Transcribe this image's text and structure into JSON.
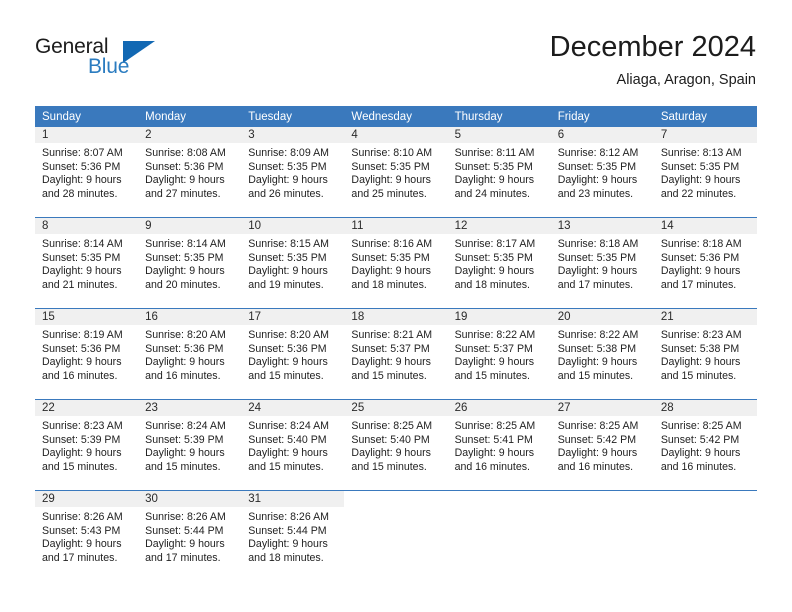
{
  "brand": {
    "name_part1": "General",
    "name_part2": "Blue",
    "logo_icon": "triangle-logo-icon"
  },
  "header": {
    "title": "December 2024",
    "subtitle": "Aliaga, Aragon, Spain"
  },
  "colors": {
    "header_blue": "#3a79bd",
    "brand_blue": "#1268b3",
    "daynum_band": "#f0f0f0",
    "text": "#222222"
  },
  "weekdays": [
    "Sunday",
    "Monday",
    "Tuesday",
    "Wednesday",
    "Thursday",
    "Friday",
    "Saturday"
  ],
  "weeks": [
    [
      {
        "day": "1",
        "sunrise": "Sunrise: 8:07 AM",
        "sunset": "Sunset: 5:36 PM",
        "daylight1": "Daylight: 9 hours",
        "daylight2": "and 28 minutes."
      },
      {
        "day": "2",
        "sunrise": "Sunrise: 8:08 AM",
        "sunset": "Sunset: 5:36 PM",
        "daylight1": "Daylight: 9 hours",
        "daylight2": "and 27 minutes."
      },
      {
        "day": "3",
        "sunrise": "Sunrise: 8:09 AM",
        "sunset": "Sunset: 5:35 PM",
        "daylight1": "Daylight: 9 hours",
        "daylight2": "and 26 minutes."
      },
      {
        "day": "4",
        "sunrise": "Sunrise: 8:10 AM",
        "sunset": "Sunset: 5:35 PM",
        "daylight1": "Daylight: 9 hours",
        "daylight2": "and 25 minutes."
      },
      {
        "day": "5",
        "sunrise": "Sunrise: 8:11 AM",
        "sunset": "Sunset: 5:35 PM",
        "daylight1": "Daylight: 9 hours",
        "daylight2": "and 24 minutes."
      },
      {
        "day": "6",
        "sunrise": "Sunrise: 8:12 AM",
        "sunset": "Sunset: 5:35 PM",
        "daylight1": "Daylight: 9 hours",
        "daylight2": "and 23 minutes."
      },
      {
        "day": "7",
        "sunrise": "Sunrise: 8:13 AM",
        "sunset": "Sunset: 5:35 PM",
        "daylight1": "Daylight: 9 hours",
        "daylight2": "and 22 minutes."
      }
    ],
    [
      {
        "day": "8",
        "sunrise": "Sunrise: 8:14 AM",
        "sunset": "Sunset: 5:35 PM",
        "daylight1": "Daylight: 9 hours",
        "daylight2": "and 21 minutes."
      },
      {
        "day": "9",
        "sunrise": "Sunrise: 8:14 AM",
        "sunset": "Sunset: 5:35 PM",
        "daylight1": "Daylight: 9 hours",
        "daylight2": "and 20 minutes."
      },
      {
        "day": "10",
        "sunrise": "Sunrise: 8:15 AM",
        "sunset": "Sunset: 5:35 PM",
        "daylight1": "Daylight: 9 hours",
        "daylight2": "and 19 minutes."
      },
      {
        "day": "11",
        "sunrise": "Sunrise: 8:16 AM",
        "sunset": "Sunset: 5:35 PM",
        "daylight1": "Daylight: 9 hours",
        "daylight2": "and 18 minutes."
      },
      {
        "day": "12",
        "sunrise": "Sunrise: 8:17 AM",
        "sunset": "Sunset: 5:35 PM",
        "daylight1": "Daylight: 9 hours",
        "daylight2": "and 18 minutes."
      },
      {
        "day": "13",
        "sunrise": "Sunrise: 8:18 AM",
        "sunset": "Sunset: 5:35 PM",
        "daylight1": "Daylight: 9 hours",
        "daylight2": "and 17 minutes."
      },
      {
        "day": "14",
        "sunrise": "Sunrise: 8:18 AM",
        "sunset": "Sunset: 5:36 PM",
        "daylight1": "Daylight: 9 hours",
        "daylight2": "and 17 minutes."
      }
    ],
    [
      {
        "day": "15",
        "sunrise": "Sunrise: 8:19 AM",
        "sunset": "Sunset: 5:36 PM",
        "daylight1": "Daylight: 9 hours",
        "daylight2": "and 16 minutes."
      },
      {
        "day": "16",
        "sunrise": "Sunrise: 8:20 AM",
        "sunset": "Sunset: 5:36 PM",
        "daylight1": "Daylight: 9 hours",
        "daylight2": "and 16 minutes."
      },
      {
        "day": "17",
        "sunrise": "Sunrise: 8:20 AM",
        "sunset": "Sunset: 5:36 PM",
        "daylight1": "Daylight: 9 hours",
        "daylight2": "and 15 minutes."
      },
      {
        "day": "18",
        "sunrise": "Sunrise: 8:21 AM",
        "sunset": "Sunset: 5:37 PM",
        "daylight1": "Daylight: 9 hours",
        "daylight2": "and 15 minutes."
      },
      {
        "day": "19",
        "sunrise": "Sunrise: 8:22 AM",
        "sunset": "Sunset: 5:37 PM",
        "daylight1": "Daylight: 9 hours",
        "daylight2": "and 15 minutes."
      },
      {
        "day": "20",
        "sunrise": "Sunrise: 8:22 AM",
        "sunset": "Sunset: 5:38 PM",
        "daylight1": "Daylight: 9 hours",
        "daylight2": "and 15 minutes."
      },
      {
        "day": "21",
        "sunrise": "Sunrise: 8:23 AM",
        "sunset": "Sunset: 5:38 PM",
        "daylight1": "Daylight: 9 hours",
        "daylight2": "and 15 minutes."
      }
    ],
    [
      {
        "day": "22",
        "sunrise": "Sunrise: 8:23 AM",
        "sunset": "Sunset: 5:39 PM",
        "daylight1": "Daylight: 9 hours",
        "daylight2": "and 15 minutes."
      },
      {
        "day": "23",
        "sunrise": "Sunrise: 8:24 AM",
        "sunset": "Sunset: 5:39 PM",
        "daylight1": "Daylight: 9 hours",
        "daylight2": "and 15 minutes."
      },
      {
        "day": "24",
        "sunrise": "Sunrise: 8:24 AM",
        "sunset": "Sunset: 5:40 PM",
        "daylight1": "Daylight: 9 hours",
        "daylight2": "and 15 minutes."
      },
      {
        "day": "25",
        "sunrise": "Sunrise: 8:25 AM",
        "sunset": "Sunset: 5:40 PM",
        "daylight1": "Daylight: 9 hours",
        "daylight2": "and 15 minutes."
      },
      {
        "day": "26",
        "sunrise": "Sunrise: 8:25 AM",
        "sunset": "Sunset: 5:41 PM",
        "daylight1": "Daylight: 9 hours",
        "daylight2": "and 16 minutes."
      },
      {
        "day": "27",
        "sunrise": "Sunrise: 8:25 AM",
        "sunset": "Sunset: 5:42 PM",
        "daylight1": "Daylight: 9 hours",
        "daylight2": "and 16 minutes."
      },
      {
        "day": "28",
        "sunrise": "Sunrise: 8:25 AM",
        "sunset": "Sunset: 5:42 PM",
        "daylight1": "Daylight: 9 hours",
        "daylight2": "and 16 minutes."
      }
    ],
    [
      {
        "day": "29",
        "sunrise": "Sunrise: 8:26 AM",
        "sunset": "Sunset: 5:43 PM",
        "daylight1": "Daylight: 9 hours",
        "daylight2": "and 17 minutes."
      },
      {
        "day": "30",
        "sunrise": "Sunrise: 8:26 AM",
        "sunset": "Sunset: 5:44 PM",
        "daylight1": "Daylight: 9 hours",
        "daylight2": "and 17 minutes."
      },
      {
        "day": "31",
        "sunrise": "Sunrise: 8:26 AM",
        "sunset": "Sunset: 5:44 PM",
        "daylight1": "Daylight: 9 hours",
        "daylight2": "and 18 minutes."
      },
      {
        "day": "",
        "sunrise": "",
        "sunset": "",
        "daylight1": "",
        "daylight2": ""
      },
      {
        "day": "",
        "sunrise": "",
        "sunset": "",
        "daylight1": "",
        "daylight2": ""
      },
      {
        "day": "",
        "sunrise": "",
        "sunset": "",
        "daylight1": "",
        "daylight2": ""
      },
      {
        "day": "",
        "sunrise": "",
        "sunset": "",
        "daylight1": "",
        "daylight2": ""
      }
    ]
  ]
}
